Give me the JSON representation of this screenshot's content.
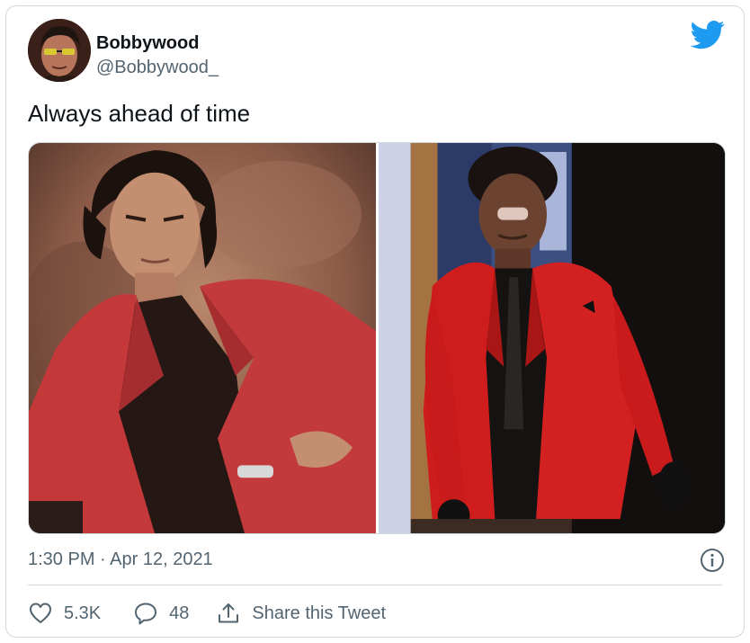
{
  "author": {
    "display_name": "Bobbywood",
    "handle": "@Bobbywood_"
  },
  "tweet": {
    "text": "Always ahead of time",
    "timestamp": "1:30 PM · Apr 12, 2021"
  },
  "media": {
    "images": [
      {
        "subject": "man in red blazer, vintage portrait"
      },
      {
        "subject": "man in red blazer with bandaged nose on stage"
      }
    ]
  },
  "actions": {
    "likes": "5.3K",
    "replies": "48",
    "share_label": "Share this Tweet"
  },
  "icons": {
    "brand": "twitter-bird-icon",
    "info": "info-icon",
    "like": "heart-icon",
    "reply": "reply-bubble-icon",
    "share": "share-icon"
  },
  "colors": {
    "brand_blue": "#1d9bf0",
    "secondary_text": "#536471",
    "primary_text": "#0f1419",
    "border": "#cfd9de"
  }
}
